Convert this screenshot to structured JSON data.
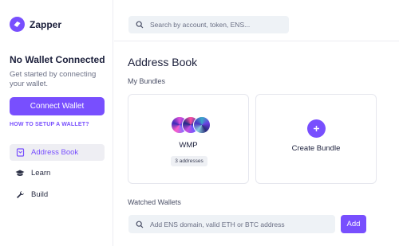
{
  "brand": {
    "name": "Zapper",
    "accent": "#784ffe"
  },
  "sidebar": {
    "wallet_title": "No Wallet Connected",
    "wallet_subtitle": "Get started by connecting your wallet.",
    "connect_label": "Connect Wallet",
    "howto_label": "HOW TO SETUP A WALLET?",
    "nav": [
      {
        "label": "Address Book",
        "icon": "address-book-icon",
        "active": true
      },
      {
        "label": "Learn",
        "icon": "graduation-cap-icon",
        "active": false
      },
      {
        "label": "Build",
        "icon": "wrench-icon",
        "active": false
      }
    ]
  },
  "header": {
    "search_placeholder": "Search by account, token, ENS..."
  },
  "main": {
    "title": "Address Book",
    "bundles_label": "My Bundles",
    "bundles": [
      {
        "name": "WMP",
        "badge": "3 addresses"
      }
    ],
    "create_bundle_label": "Create Bundle",
    "watched_label": "Watched Wallets",
    "watch_placeholder": "Add ENS domain, valid ETH or BTC address",
    "add_label": "Add"
  }
}
